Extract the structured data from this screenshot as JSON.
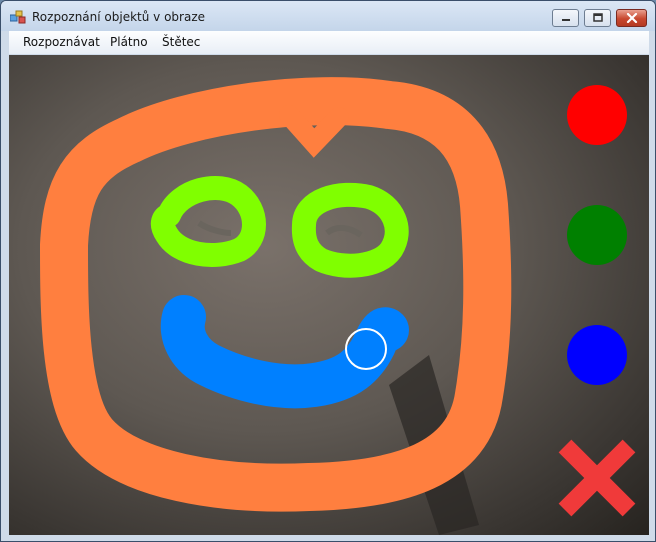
{
  "window": {
    "title": "Rozpoznání objektů v obraze"
  },
  "menu": {
    "items": [
      {
        "label": "Rozpoznávat"
      },
      {
        "label": "Plátno"
      },
      {
        "label": "Štětec"
      }
    ]
  },
  "palette": {
    "colors": [
      "#ff0000",
      "#008000",
      "#0000ff"
    ],
    "clear_icon": "x-icon",
    "clear_color": "#f03a3a"
  },
  "drawing": {
    "face_outline_color": "#ff7f3f",
    "eyes_color": "#80ff00",
    "mouth_color": "#0080ff"
  }
}
